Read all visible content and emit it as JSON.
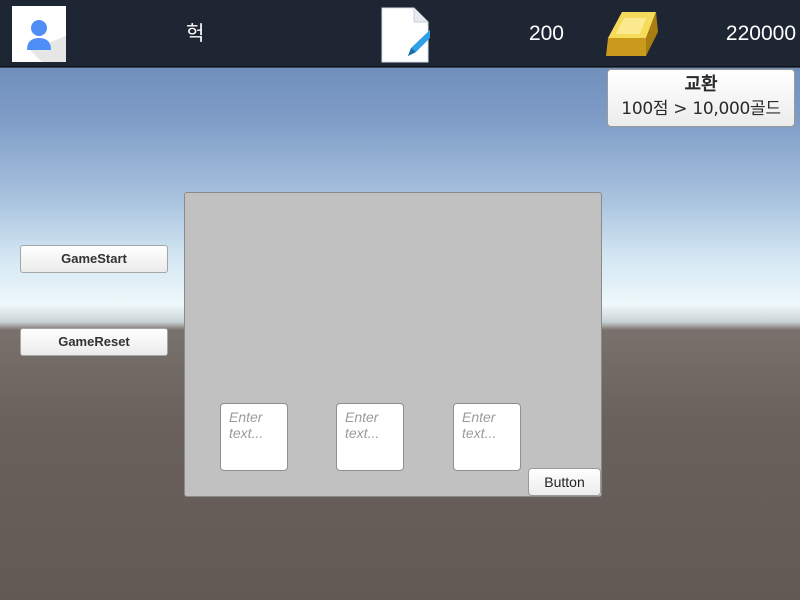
{
  "hud": {
    "avatar_icon": "user-avatar-icon",
    "nickname": "헉",
    "score_icon": "note-pencil-icon",
    "score": "200",
    "gold_icon": "gold-bar-icon",
    "gold": "220000"
  },
  "exchange": {
    "title": "교환",
    "rate": "100점 > 10,000골드"
  },
  "side_buttons": {
    "start": "GameStart",
    "reset": "GameReset"
  },
  "panel": {
    "inputs": [
      {
        "placeholder": "Enter text...",
        "value": ""
      },
      {
        "placeholder": "Enter text...",
        "value": ""
      },
      {
        "placeholder": "Enter text...",
        "value": ""
      }
    ],
    "button": "Button"
  },
  "colors": {
    "topbar": "#1e2533",
    "panel": "#c1c1c1",
    "avatar_accent": "#4f8ef7",
    "pencil": "#2f9fe6",
    "gold": "#e8c33a"
  }
}
